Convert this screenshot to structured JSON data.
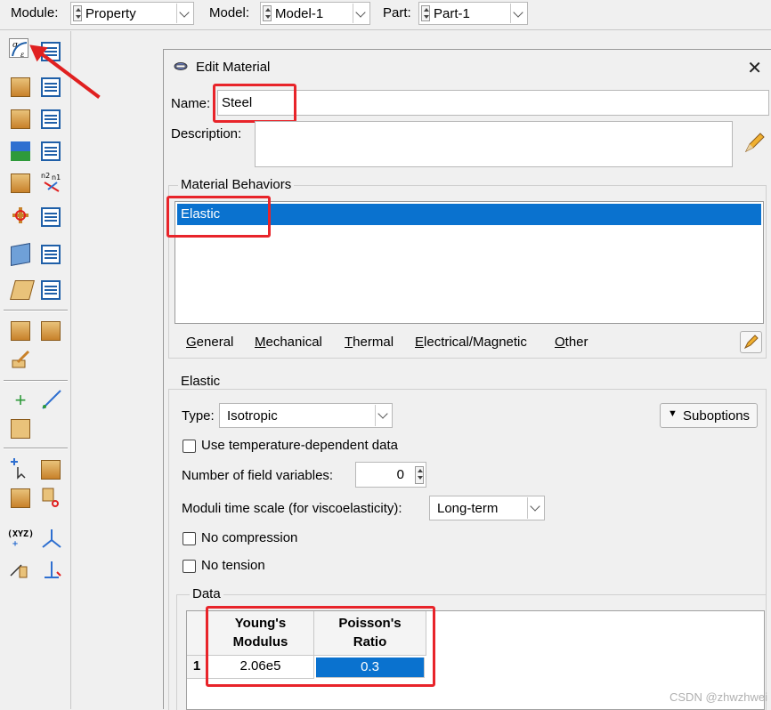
{
  "top_bar": {
    "module_label": "Module:",
    "module_value": "Property",
    "model_label": "Model:",
    "model_value": "Model-1",
    "part_label": "Part:",
    "part_value": "Part-1"
  },
  "dialog": {
    "title": "Edit Material",
    "name_label": "Name:",
    "name_value": "Steel",
    "description_label": "Description:",
    "description_value": "",
    "behaviors_group": "Material Behaviors",
    "behaviors": [
      "Elastic"
    ],
    "menu": [
      "General",
      "Mechanical",
      "Thermal",
      "Electrical/Magnetic",
      "Other"
    ],
    "elastic_group": "Elastic",
    "type_label": "Type:",
    "type_value": "Isotropic",
    "suboptions_label": "Suboptions",
    "temp_dependent_label": "Use temperature-dependent data",
    "field_vars_label": "Number of field variables:",
    "field_vars_value": "0",
    "moduli_label": "Moduli time scale (for viscoelasticity):",
    "moduli_value": "Long-term",
    "no_compression_label": "No compression",
    "no_tension_label": "No tension",
    "data_group": "Data",
    "table": {
      "col1_line1": "Young's",
      "col1_line2": "Modulus",
      "col2_line1": "Poisson's",
      "col2_line2": "Ratio",
      "row_index": "1",
      "youngs_modulus": "2.06e5",
      "poissons_ratio": "0.3"
    }
  },
  "watermark": "CSDN @zhwzhwei",
  "colors": {
    "selection": "#0a72cf",
    "highlight_box": "#e8242a",
    "arrow": "#e02020"
  }
}
